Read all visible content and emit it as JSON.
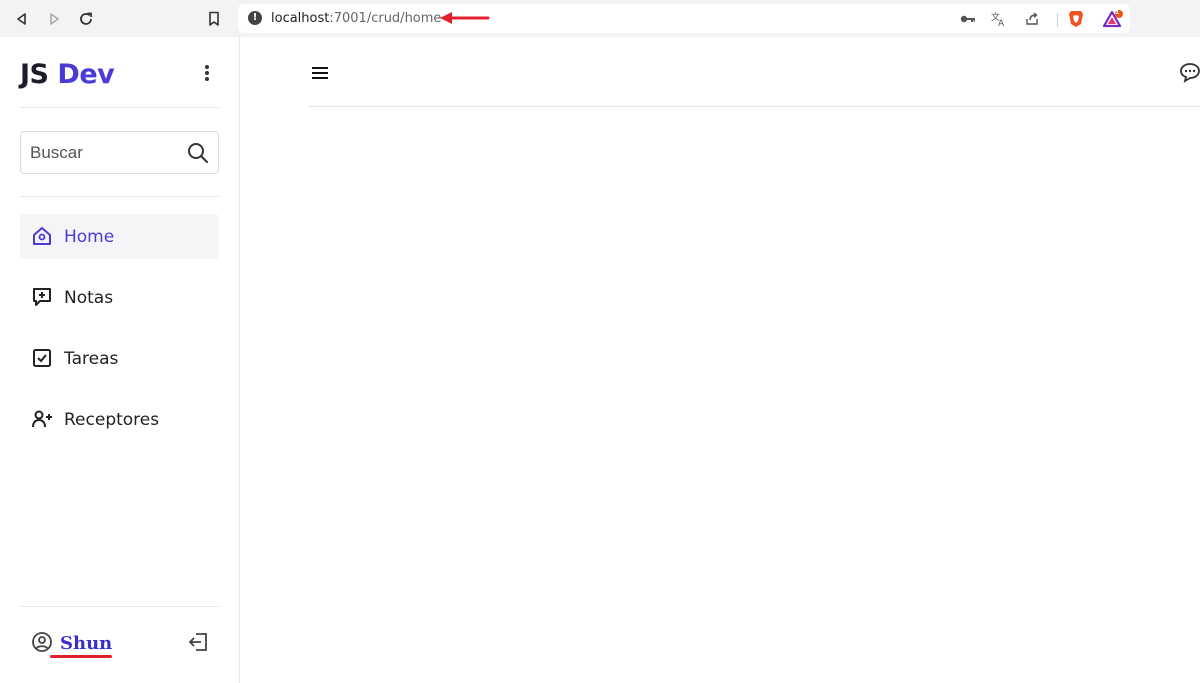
{
  "browser": {
    "url_host": "localhost",
    "url_path": ":7001/crud/home",
    "icons": [
      "back-icon",
      "forward-icon",
      "reload-icon",
      "bookmark-icon",
      "site-info-icon",
      "key-icon",
      "translate-icon",
      "share-icon",
      "brave-shield-icon",
      "brave-rewards-icon"
    ],
    "rewards_badge": "1"
  },
  "sidebar": {
    "logo_js": "JS",
    "logo_dev": "Dev",
    "search": {
      "placeholder": "Buscar"
    },
    "items": [
      {
        "label": "Home",
        "icon": "home-icon",
        "active": true
      },
      {
        "label": "Notas",
        "icon": "message-plus-icon",
        "active": false
      },
      {
        "label": "Tareas",
        "icon": "checkbox-icon",
        "active": false
      },
      {
        "label": "Receptores",
        "icon": "user-plus-icon",
        "active": false
      }
    ],
    "user": {
      "name": "Shun",
      "icon": "user-circle-icon"
    },
    "logout_icon": "logout-icon"
  },
  "main": {
    "menu_icon": "hamburger-icon",
    "chat_icon": "chat-bubble-icon"
  },
  "colors": {
    "accent": "#4b3bd6",
    "annotation": "#e0202e",
    "chrome": "#f2f3f5"
  }
}
